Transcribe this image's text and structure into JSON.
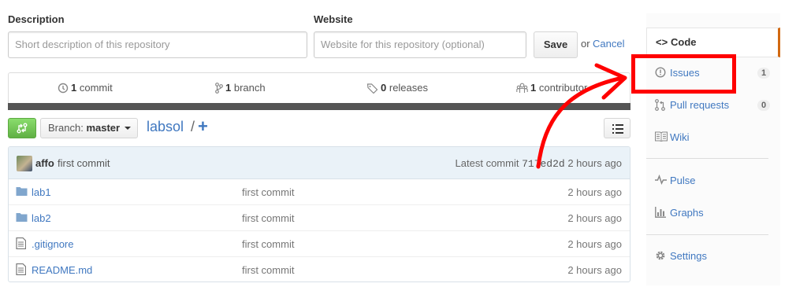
{
  "settings": {
    "description_label": "Description",
    "description_placeholder": "Short description of this repository",
    "website_label": "Website",
    "website_placeholder": "Website for this repository (optional)",
    "save_label": "Save",
    "or_text": "or",
    "cancel_label": "Cancel"
  },
  "summary": {
    "commits_count": "1",
    "commits_label": "commit",
    "branches_count": "1",
    "branches_label": "branch",
    "releases_count": "0",
    "releases_label": "releases",
    "contributors_count": "1",
    "contributors_label": "contributor"
  },
  "toolbar": {
    "branch_prefix": "Branch:",
    "branch_name": "master",
    "repo_name": "labsol",
    "path_sep": "/",
    "add_glyph": "+"
  },
  "commit_tease": {
    "author": "affo",
    "message": "first commit",
    "latest_label": "Latest commit",
    "sha": "717ed2d",
    "age": "2 hours ago"
  },
  "files": [
    {
      "type": "dir",
      "name": "lab1",
      "message": "first commit",
      "age": "2 hours ago"
    },
    {
      "type": "dir",
      "name": "lab2",
      "message": "first commit",
      "age": "2 hours ago"
    },
    {
      "type": "file",
      "name": ".gitignore",
      "message": "first commit",
      "age": "2 hours ago"
    },
    {
      "type": "file",
      "name": "README.md",
      "message": "first commit",
      "age": "2 hours ago"
    }
  ],
  "sidebar": {
    "code": "Code",
    "issues": "Issues",
    "issues_count": "1",
    "pulls": "Pull requests",
    "pulls_count": "0",
    "wiki": "Wiki",
    "pulse": "Pulse",
    "graphs": "Graphs",
    "settings": "Settings"
  },
  "colors": {
    "accent_link": "#4078c0",
    "compare_green": "#6cc644",
    "annotation_red": "#ff0000",
    "selected_orange": "#d26911"
  },
  "icons": {
    "compare": "git-compare-icon",
    "list": "list-unordered-icon",
    "folder": "folder-icon",
    "file": "file-text-icon"
  }
}
